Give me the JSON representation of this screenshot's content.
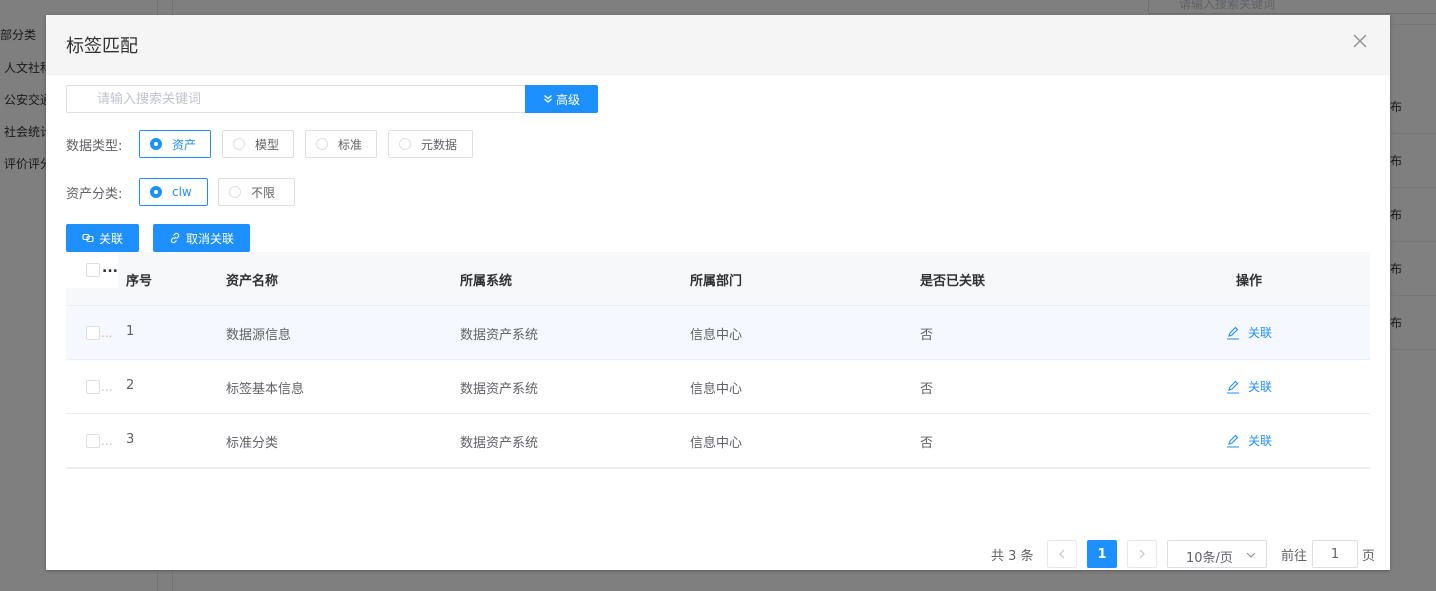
{
  "background": {
    "sidebar_items": [
      "部分类",
      "人文社科",
      "公安交通",
      "社会统计",
      "评价评分"
    ],
    "search_placeholder": "请输入搜索关键词",
    "row_status": "布"
  },
  "dialog": {
    "title": "标签匹配",
    "search": {
      "placeholder": "请输入搜索关键词",
      "value": ""
    },
    "advanced_label": "高级",
    "data_type": {
      "label": "数据类型:",
      "options": [
        "资产",
        "模型",
        "标准",
        "元数据"
      ],
      "selected": "资产"
    },
    "asset_category": {
      "label": "资产分类:",
      "options": [
        "clw",
        "不限"
      ],
      "selected": "clw"
    },
    "actions": {
      "link_label": "关联",
      "unlink_label": "取消关联"
    },
    "table": {
      "check_ellipsis": "...",
      "headers": {
        "index": "序号",
        "name": "资产名称",
        "system": "所属系统",
        "department": "所属部门",
        "linked": "是否已关联",
        "operation": "操作"
      },
      "rows": [
        {
          "index": "1",
          "name": "数据源信息",
          "system": "数据资产系统",
          "department": "信息中心",
          "linked": "否",
          "op": "关联"
        },
        {
          "index": "2",
          "name": "标签基本信息",
          "system": "数据资产系统",
          "department": "信息中心",
          "linked": "否",
          "op": "关联"
        },
        {
          "index": "3",
          "name": "标准分类",
          "system": "数据资产系统",
          "department": "信息中心",
          "linked": "否",
          "op": "关联"
        }
      ]
    },
    "pagination": {
      "total_text": "共 3 条",
      "current_page": "1",
      "page_size": "10条/页",
      "goto_label": "前往",
      "goto_value": "1",
      "page_suffix": "页"
    }
  },
  "colors": {
    "primary": "#1e8fff",
    "header_bg": "#f5f5f5",
    "table_header_bg": "#f7f8fa"
  }
}
